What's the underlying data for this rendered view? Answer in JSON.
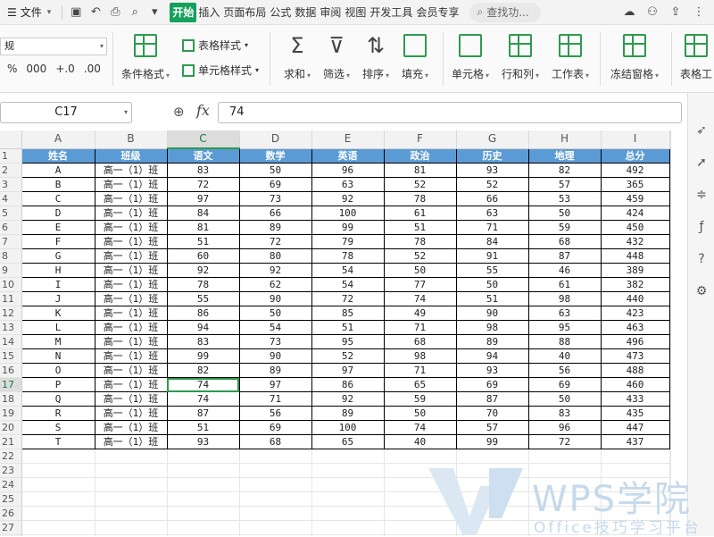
{
  "menubar": {
    "file_label": "文件",
    "tabs": [
      "开始",
      "插入",
      "页面布局",
      "公式",
      "数据",
      "审阅",
      "视图",
      "开发工具",
      "会员专享"
    ],
    "active_tab": "开始",
    "search_placeholder": "查找功..."
  },
  "ribbon": {
    "number_format_value": "规",
    "number_format_symbols": [
      "%",
      "000",
      "+.0",
      ".00"
    ],
    "buttons": {
      "conditional_format": "条件格式",
      "table_style": "表格样式",
      "cell_style": "单元格样式",
      "sum": "求和",
      "filter": "筛选",
      "sort": "排序",
      "fill": "填充",
      "cell": "单元格",
      "row_col": "行和列",
      "worksheet": "工作表",
      "freeze": "冻结窗格",
      "table_tool": "表格工"
    }
  },
  "formula_bar": {
    "cell_ref": "C17",
    "value": "74"
  },
  "grid": {
    "columns": [
      "A",
      "B",
      "C",
      "D",
      "E",
      "F",
      "G",
      "H",
      "I"
    ],
    "selected_column": "C",
    "selected_row": 17,
    "header_row": [
      "姓名",
      "班级",
      "语文",
      "数学",
      "英语",
      "政治",
      "历史",
      "地理",
      "总分"
    ],
    "rows": [
      [
        "A",
        "高一（1）班",
        "83",
        "50",
        "96",
        "81",
        "93",
        "82",
        "492"
      ],
      [
        "B",
        "高一（1）班",
        "72",
        "69",
        "63",
        "52",
        "52",
        "57",
        "365"
      ],
      [
        "C",
        "高一（1）班",
        "97",
        "73",
        "92",
        "78",
        "66",
        "53",
        "459"
      ],
      [
        "D",
        "高一（1）班",
        "84",
        "66",
        "100",
        "61",
        "63",
        "50",
        "424"
      ],
      [
        "E",
        "高一（1）班",
        "81",
        "89",
        "99",
        "51",
        "71",
        "59",
        "450"
      ],
      [
        "F",
        "高一（1）班",
        "51",
        "72",
        "79",
        "78",
        "84",
        "68",
        "432"
      ],
      [
        "G",
        "高一（1）班",
        "60",
        "80",
        "78",
        "52",
        "91",
        "87",
        "448"
      ],
      [
        "H",
        "高一（1）班",
        "92",
        "92",
        "54",
        "50",
        "55",
        "46",
        "389"
      ],
      [
        "I",
        "高一（1）班",
        "78",
        "62",
        "54",
        "77",
        "50",
        "61",
        "382"
      ],
      [
        "J",
        "高一（1）班",
        "55",
        "90",
        "72",
        "74",
        "51",
        "98",
        "440"
      ],
      [
        "K",
        "高一（1）班",
        "86",
        "50",
        "85",
        "49",
        "90",
        "63",
        "423"
      ],
      [
        "L",
        "高一（1）班",
        "94",
        "54",
        "51",
        "71",
        "98",
        "95",
        "463"
      ],
      [
        "M",
        "高一（1）班",
        "83",
        "73",
        "95",
        "68",
        "89",
        "88",
        "496"
      ],
      [
        "N",
        "高一（1）班",
        "99",
        "90",
        "52",
        "98",
        "94",
        "40",
        "473"
      ],
      [
        "O",
        "高一（1）班",
        "82",
        "89",
        "97",
        "71",
        "93",
        "56",
        "488"
      ],
      [
        "P",
        "高一（1）班",
        "74",
        "97",
        "86",
        "65",
        "69",
        "69",
        "460"
      ],
      [
        "Q",
        "高一（1）班",
        "74",
        "71",
        "92",
        "59",
        "87",
        "50",
        "433"
      ],
      [
        "R",
        "高一（1）班",
        "87",
        "56",
        "89",
        "50",
        "70",
        "83",
        "435"
      ],
      [
        "S",
        "高一（1）班",
        "51",
        "69",
        "100",
        "74",
        "57",
        "96",
        "447"
      ],
      [
        "T",
        "高一（1）班",
        "93",
        "68",
        "65",
        "40",
        "99",
        "72",
        "437"
      ]
    ],
    "empty_rows": [
      22,
      23,
      24,
      25,
      26,
      27,
      28
    ]
  },
  "watermark": {
    "brand": "WPS学院",
    "tagline": "Office技巧学习平台"
  },
  "colors": {
    "accent_green": "#15a15c",
    "header_blue": "#5b9bd5"
  }
}
